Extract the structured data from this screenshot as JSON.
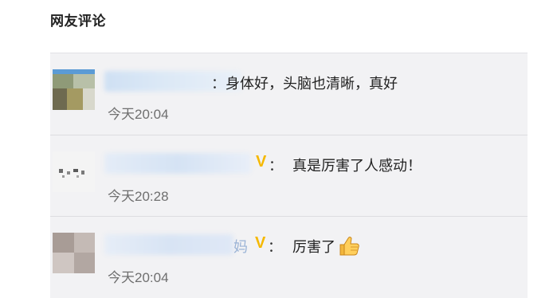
{
  "section": {
    "title": "网友评论"
  },
  "comments": [
    {
      "separator": "：",
      "text": "身体好，头脑也清晰，真好",
      "time": "今天20:04",
      "vip": false
    },
    {
      "separator": "：",
      "text": "真是厉害了人感动！",
      "time": "今天20:28",
      "vip": true,
      "vip_label": "V"
    },
    {
      "separator": "：",
      "text": "厉害了",
      "emoji": "thumbs-up-icon",
      "time": "今天20:04",
      "vip": true,
      "vip_label": "V",
      "username_fragment": "妈"
    }
  ],
  "colors": {
    "panel_bg": "#f2f2f4",
    "vip_badge": "#f5b800",
    "timestamp": "#6f6f6f"
  }
}
